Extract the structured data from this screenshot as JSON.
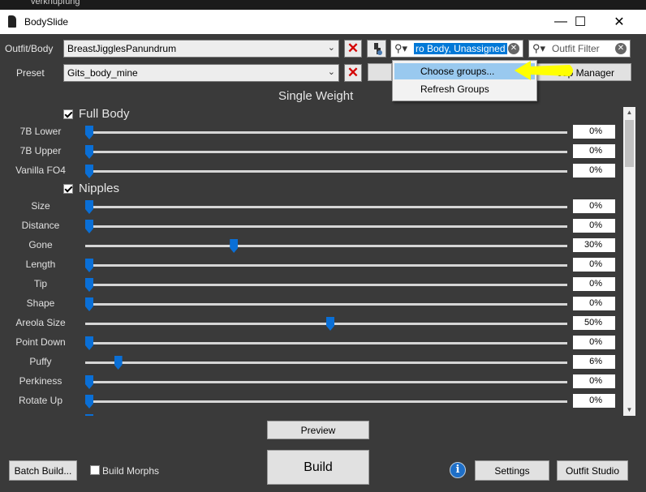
{
  "desktop": {
    "text": "verknüpfung"
  },
  "window": {
    "title": "BodySlide",
    "minimize_glyph": "—",
    "maximize_glyph": "☐",
    "close_glyph": "✕"
  },
  "toolbar": {
    "outfit_label": "Outfit/Body",
    "outfit_value": "BreastJigglesPanundrum",
    "preset_label": "Preset",
    "preset_value": "Gits_body_mine",
    "group_filter_value": "ro Body, Unassigned",
    "outfit_filter_placeholder": "Outfit Filter",
    "group_manager_label": "oup Manager",
    "remove_glyph": "✕",
    "dropdown_glyph": "⌄"
  },
  "context_menu": {
    "items": [
      {
        "label": "Choose groups...",
        "highlighted": true
      },
      {
        "label": "Refresh Groups",
        "highlighted": false
      }
    ]
  },
  "section_title": "Single Weight",
  "groups": [
    {
      "name": "Full Body",
      "sliders": [
        {
          "name": "7B Lower",
          "value": "0%",
          "fraction": 0.0
        },
        {
          "name": "7B Upper",
          "value": "0%",
          "fraction": 0.0
        },
        {
          "name": "Vanilla FO4",
          "value": "0%",
          "fraction": 0.0
        }
      ]
    },
    {
      "name": "Nipples",
      "sliders": [
        {
          "name": "Size",
          "value": "0%",
          "fraction": 0.0
        },
        {
          "name": "Distance",
          "value": "0%",
          "fraction": 0.0
        },
        {
          "name": "Gone",
          "value": "30%",
          "fraction": 0.3
        },
        {
          "name": "Length",
          "value": "0%",
          "fraction": 0.0
        },
        {
          "name": "Tip",
          "value": "0%",
          "fraction": 0.0
        },
        {
          "name": "Shape",
          "value": "0%",
          "fraction": 0.0
        },
        {
          "name": "Areola Size",
          "value": "50%",
          "fraction": 0.5
        },
        {
          "name": "Point Down",
          "value": "0%",
          "fraction": 0.0
        },
        {
          "name": "Puffy",
          "value": "6%",
          "fraction": 0.06
        },
        {
          "name": "Perkiness",
          "value": "0%",
          "fraction": 0.0
        },
        {
          "name": "Rotate Up",
          "value": "0%",
          "fraction": 0.0
        }
      ]
    }
  ],
  "bottom": {
    "preview_label": "Preview",
    "build_label": "Build",
    "batch_build_label": "Batch Build...",
    "build_morphs_label": "Build Morphs",
    "settings_label": "Settings",
    "outfit_studio_label": "Outfit Studio",
    "info_glyph": "i"
  },
  "colors": {
    "accent": "#0a6fd6",
    "remove": "#d40000",
    "highlight_arrow": "#ffff00"
  }
}
